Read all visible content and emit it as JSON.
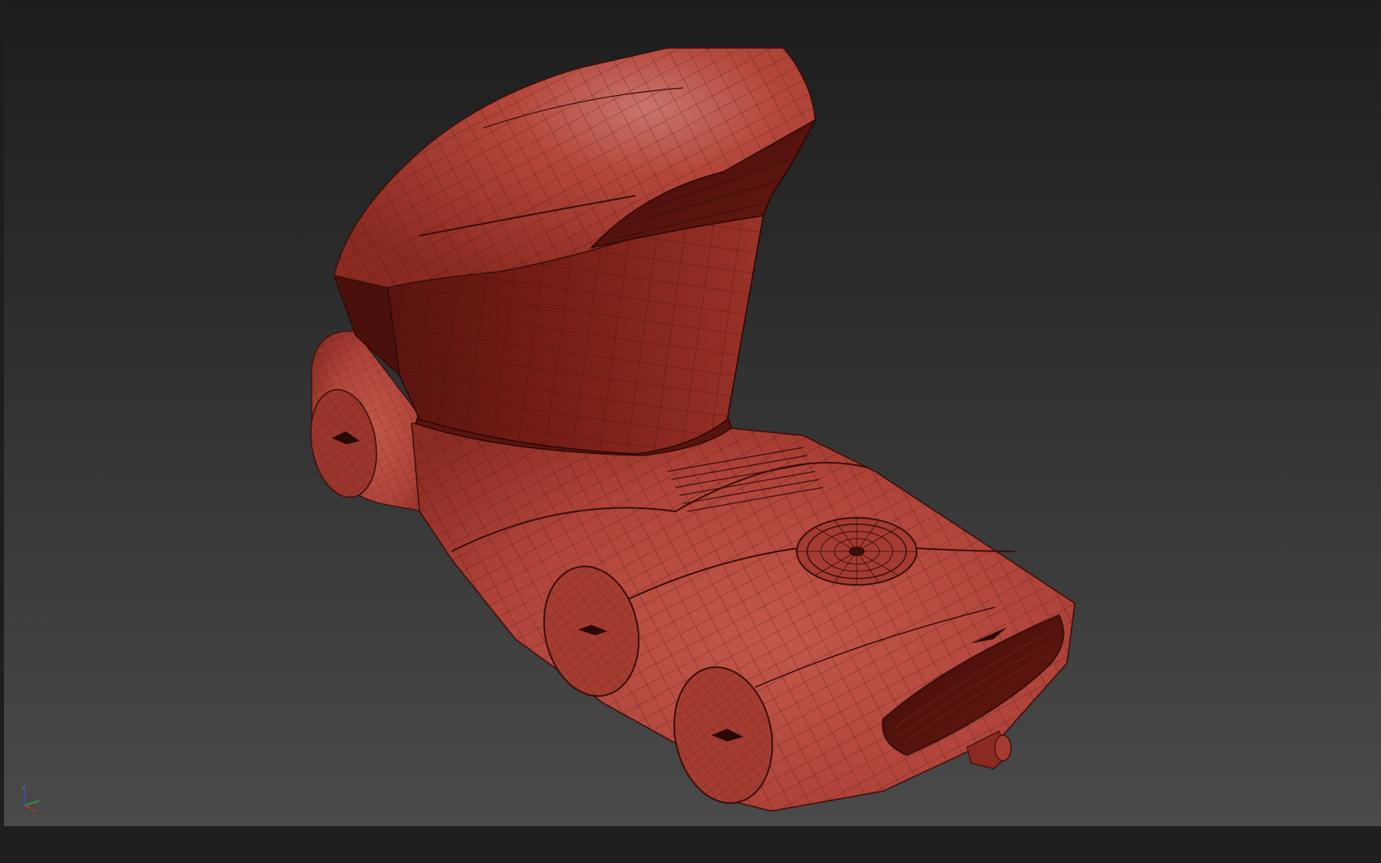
{
  "viewport": {
    "background_top": "#1d1d1d",
    "background_bottom": "#4a4a4a",
    "model_color": "#b8453a",
    "wire_color": "#3a0e0a"
  },
  "axis_gizmo": {
    "z_label": "z",
    "colors": {
      "x": "#d03030",
      "y": "#30b030",
      "z": "#3050d0"
    }
  }
}
